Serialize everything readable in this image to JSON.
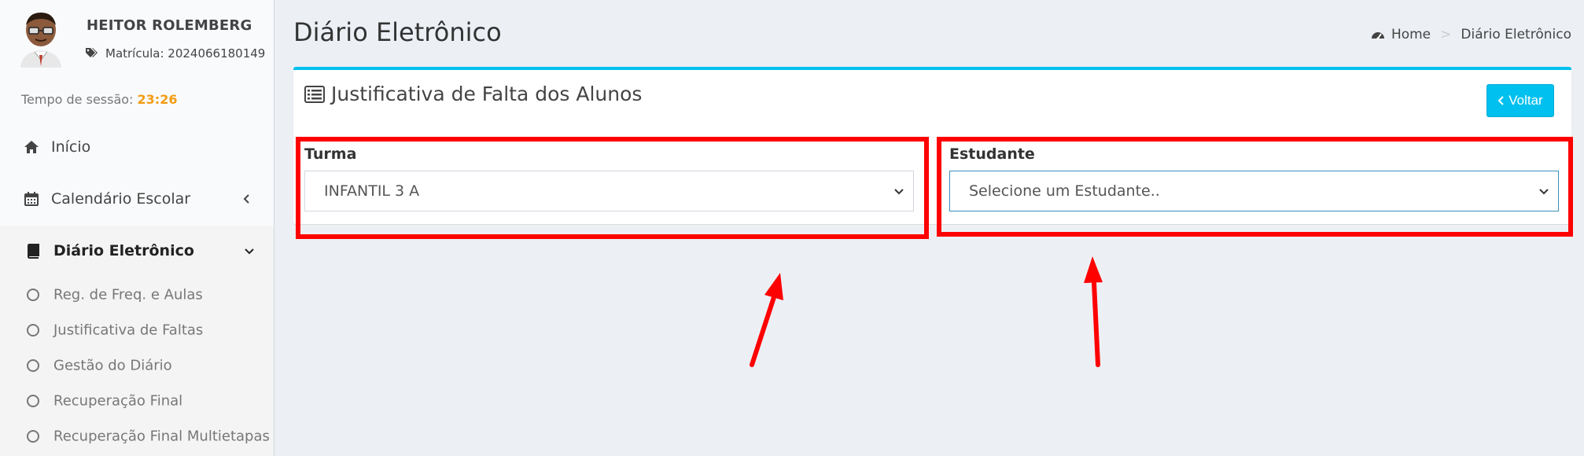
{
  "user": {
    "name": "HEITOR ROLEMBERG",
    "matricula": "Matrícula: 2024066180149",
    "session_label": "Tempo de sessão:",
    "session_time": "23:26"
  },
  "sidebar": {
    "items": [
      {
        "label": "Início",
        "icon": "home-icon"
      },
      {
        "label": "Calendário Escolar",
        "icon": "calendar-icon"
      },
      {
        "label": "Diário Eletrônico",
        "icon": "book-icon"
      }
    ],
    "subitems": [
      {
        "label": "Reg. de Freq. e Aulas"
      },
      {
        "label": "Justificativa de Faltas"
      },
      {
        "label": "Gestão do Diário"
      },
      {
        "label": "Recuperação Final"
      },
      {
        "label": "Recuperação Final Multietapas"
      }
    ]
  },
  "header": {
    "title": "Diário Eletrônico",
    "breadcrumb_home": "Home",
    "breadcrumb_sep": ">",
    "breadcrumb_current": "Diário Eletrônico"
  },
  "box": {
    "title": "Justificativa de Falta dos Alunos",
    "back_label": "Voltar",
    "turma_label": "Turma",
    "turma_value": "INFANTIL 3 A",
    "estudante_label": "Estudante",
    "estudante_placeholder": "Selecione um Estudante.."
  },
  "colors": {
    "accent": "#00c0ef",
    "highlight": "#ff0000",
    "session_time": "#f39c12"
  }
}
